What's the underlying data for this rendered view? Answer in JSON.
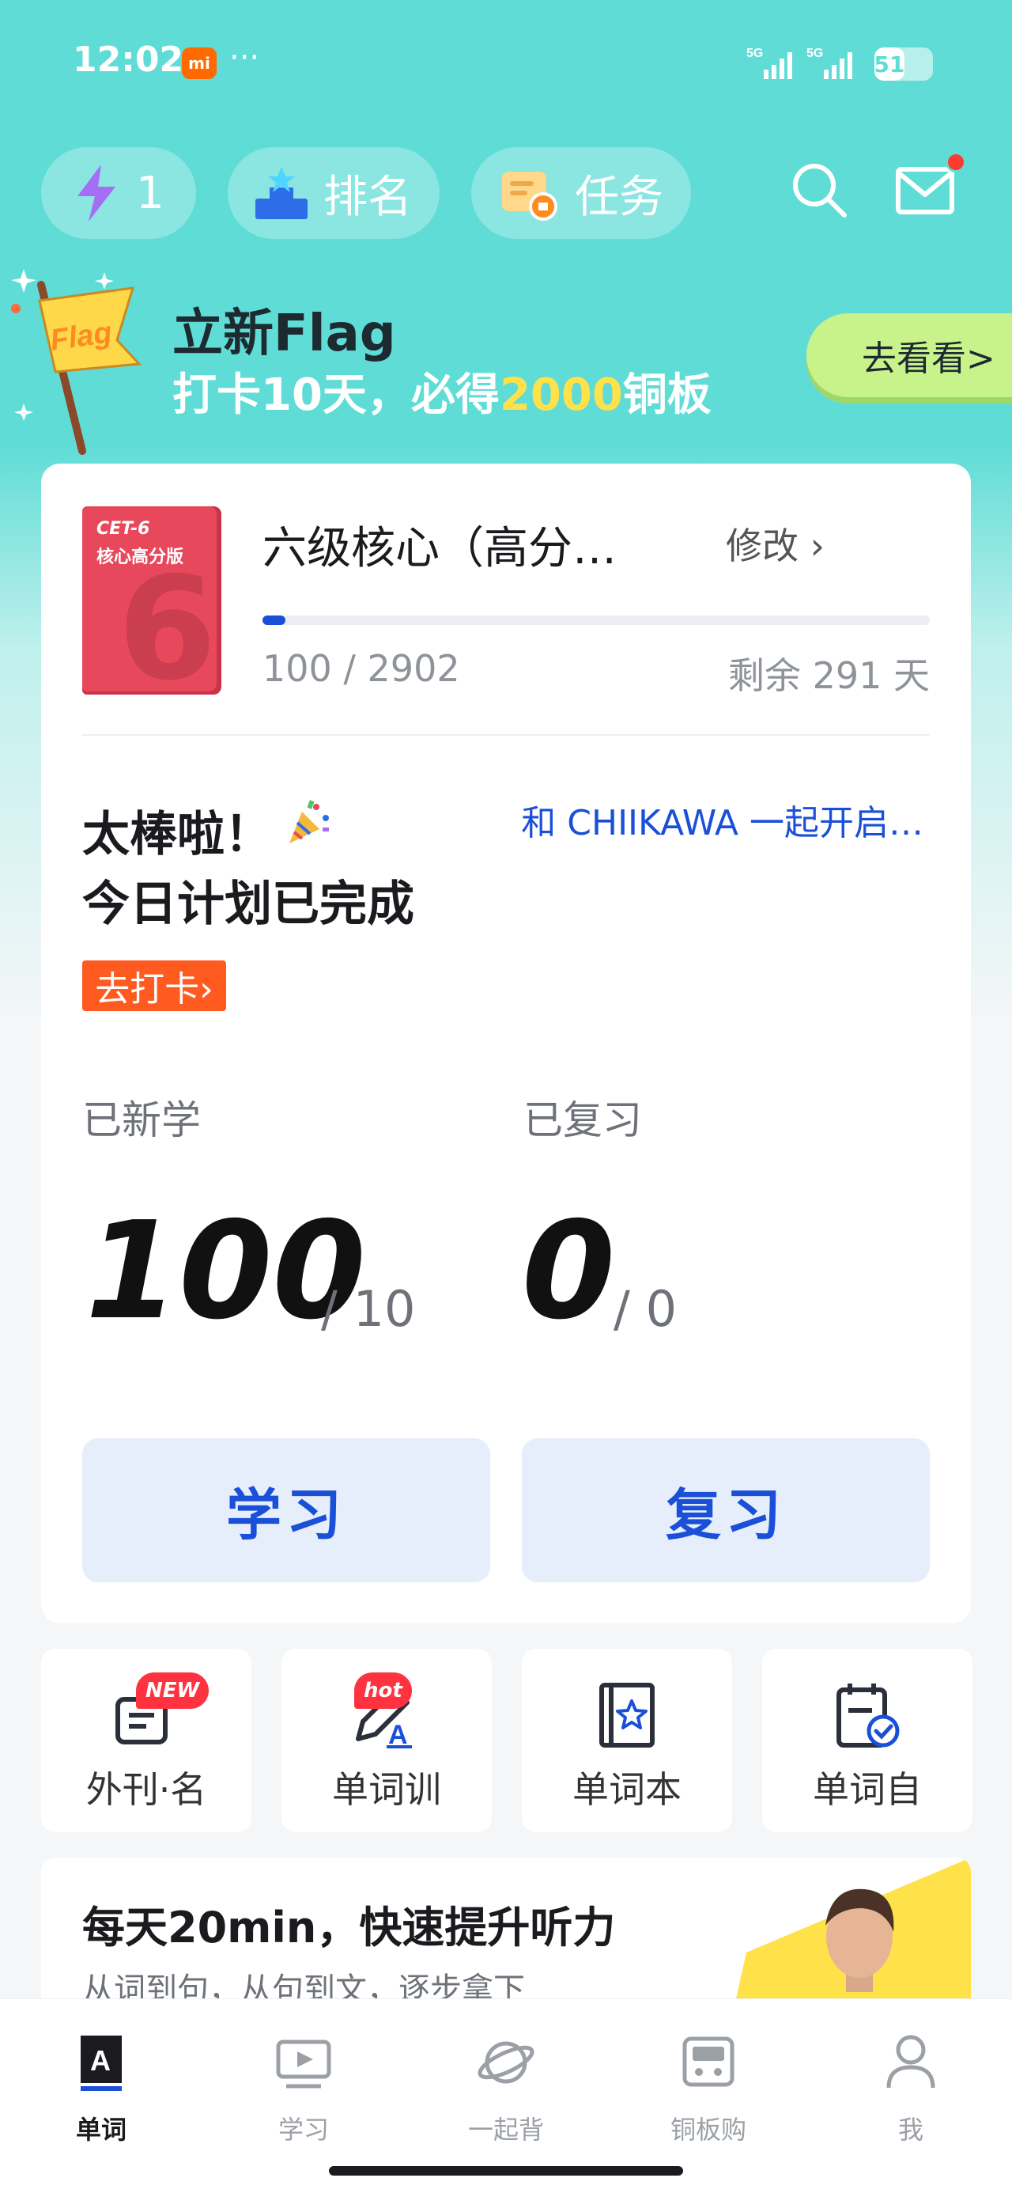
{
  "status_bar": {
    "time": "12:02",
    "carrier_badge": "mi",
    "more": "···",
    "signal_1": "5G",
    "signal_2": "5G",
    "battery": "51",
    "battery_level": 0.51
  },
  "top_bar": {
    "energy": {
      "icon": "lightning-icon",
      "count": "1"
    },
    "rank": {
      "icon": "podium-icon",
      "label": "排名"
    },
    "tasks": {
      "icon": "task-scroll-icon",
      "label": "任务"
    },
    "search_icon": "search-icon",
    "mail_icon": "mail-icon"
  },
  "flag_banner": {
    "badge_text": "Flag",
    "title": "立新Flag",
    "subtitle_pre": "打卡10天，必得",
    "subtitle_highlight": "2000",
    "subtitle_post": "铜板",
    "button": "去看看>"
  },
  "book": {
    "cover_line1": "CET-6",
    "cover_line2": "核心高分版",
    "cover_number": "6",
    "name": "六级核心（高分…",
    "edit": "修改 ›",
    "count": "100 / 2902",
    "progress": 0.0345,
    "remaining": "剩余 291 天"
  },
  "today": {
    "line1": "太棒啦！",
    "line2": "今日计划已完成",
    "link": "和 CHIIKAWA 一起开启…",
    "checkin": "去打卡›"
  },
  "stats": {
    "learned_label": "已新学",
    "learned_value": "100",
    "learned_target": "/ 10",
    "reviewed_label": "已复习",
    "reviewed_value": "0",
    "reviewed_target": "/ 0"
  },
  "actions": {
    "learn": "学习",
    "review": "复习"
  },
  "shortcuts": [
    {
      "label": "外刊·名",
      "badge": "NEW",
      "icon": "magazine-icon"
    },
    {
      "label": "单词训",
      "badge": "hot",
      "icon": "pen-train-icon"
    },
    {
      "label": "单词本",
      "badge": "",
      "icon": "wordbook-icon"
    },
    {
      "label": "单词自",
      "badge": "",
      "icon": "self-test-icon"
    }
  ],
  "promo": {
    "title": "每天20min，快速提升听力",
    "subtitle": "从词到句，从句到文，逐步拿下"
  },
  "bottom_nav": [
    {
      "label": "单词",
      "icon": "word-a-icon",
      "active": true
    },
    {
      "label": "学习",
      "icon": "video-icon",
      "active": false
    },
    {
      "label": "一起背",
      "icon": "planet-icon",
      "active": false
    },
    {
      "label": "铜板购",
      "icon": "shop-icon",
      "active": false
    },
    {
      "label": "我",
      "icon": "profile-icon",
      "active": false
    }
  ],
  "colors": {
    "teal": "#5fdcd6",
    "accent_blue": "#1a4fd8",
    "orange": "#ff5a1f",
    "green_btn": "#c8f38a",
    "yellow": "#ffe14a"
  }
}
